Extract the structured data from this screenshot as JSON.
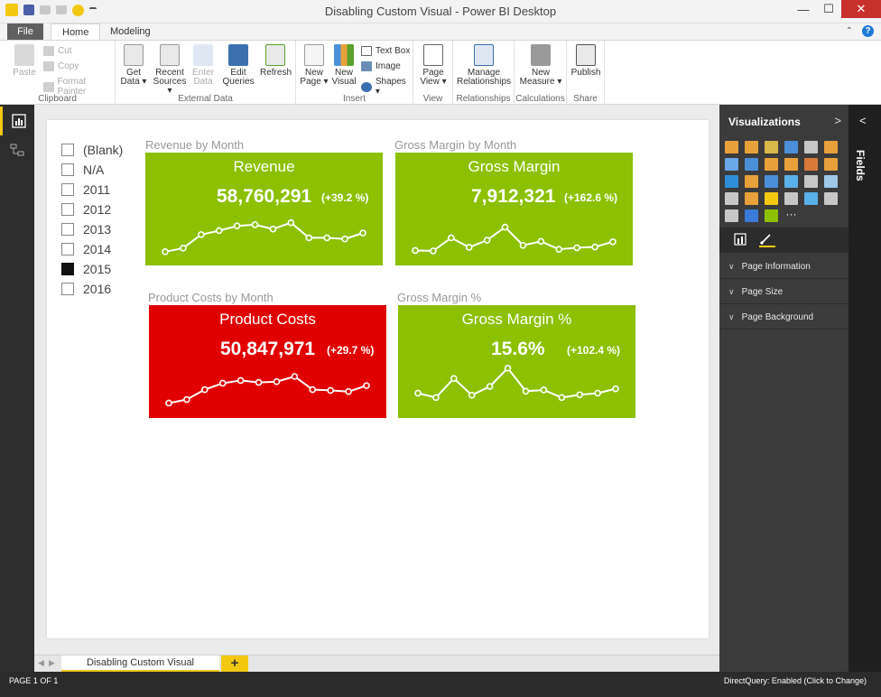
{
  "window": {
    "title": "Disabling Custom Visual - Power BI Desktop"
  },
  "window_controls": {
    "minimize": "—",
    "maximize": "☐",
    "close": "✕"
  },
  "tabs": {
    "file": "File",
    "home": "Home",
    "modeling": "Modeling"
  },
  "ribbon": {
    "clipboard": {
      "label": "Clipboard",
      "paste": "Paste",
      "cut": "Cut",
      "copy": "Copy",
      "format_painter": "Format Painter"
    },
    "external_data": {
      "label": "External Data",
      "get_data": "Get Data ▾",
      "recent_sources": "Recent Sources ▾",
      "enter_data": "Enter Data",
      "edit_queries": "Edit Queries",
      "refresh": "Refresh"
    },
    "insert": {
      "label": "Insert",
      "new_page": "New Page ▾",
      "new_visual": "New Visual",
      "text_box": "Text Box",
      "image": "Image",
      "shapes": "Shapes ▾"
    },
    "view": {
      "label": "View",
      "page_view": "Page View ▾"
    },
    "relationships": {
      "label": "Relationships",
      "manage": "Manage Relationships"
    },
    "calculations": {
      "label": "Calculations",
      "new_measure": "New Measure ▾"
    },
    "share": {
      "label": "Share",
      "publish": "Publish"
    }
  },
  "slicer": {
    "items": [
      {
        "label": "(Blank)",
        "checked": false
      },
      {
        "label": "N/A",
        "checked": false
      },
      {
        "label": "2011",
        "checked": false
      },
      {
        "label": "2012",
        "checked": false
      },
      {
        "label": "2013",
        "checked": false
      },
      {
        "label": "2014",
        "checked": false
      },
      {
        "label": "2015",
        "checked": true
      },
      {
        "label": "2016",
        "checked": false
      }
    ]
  },
  "cards": [
    {
      "visual_title": "Revenue by Month",
      "title": "Revenue",
      "value": "58,760,291",
      "change": "(+39.2 %)",
      "color": "#8cc000",
      "sparkline": [
        5,
        14,
        48,
        58,
        70,
        73,
        62,
        78,
        40,
        40,
        37,
        52
      ]
    },
    {
      "visual_title": "Gross Margin by Month",
      "title": "Gross Margin",
      "value": "7,912,321",
      "change": "(+162.6 %)",
      "color": "#8cc000",
      "sparkline": [
        8,
        7,
        40,
        16,
        34,
        67,
        21,
        31,
        11,
        15,
        17,
        30
      ]
    },
    {
      "visual_title": "Product Costs by Month",
      "title": "Product Costs",
      "value": "50,847,971",
      "change": "(+29.7 %)",
      "color": "#e00000",
      "sparkline": [
        8,
        17,
        42,
        58,
        65,
        60,
        62,
        75,
        42,
        40,
        37,
        52
      ]
    },
    {
      "visual_title": "Gross Margin %",
      "title": "Gross Margin %",
      "value": "15.6%",
      "change": "(+102.4 %)",
      "color": "#8cc000",
      "sparkline": [
        33,
        22,
        70,
        28,
        50,
        96,
        38,
        41,
        22,
        29,
        33,
        44
      ]
    }
  ],
  "viz_pane": {
    "title": "Visualizations",
    "more": "···",
    "sections": [
      "Page Information",
      "Page Size",
      "Page Background"
    ],
    "icon_colors": [
      "#e8a13a",
      "#e8a13a",
      "#d9b84a",
      "#4a8fd8",
      "#c7c7c7",
      "#e8a13a",
      "#6aa6e8",
      "#4a8fd8",
      "#e8a13a",
      "#e8a13a",
      "#d97a3a",
      "#e8a13a",
      "#2d8fd8",
      "#e8a13a",
      "#4a8fd8",
      "#5ab0e8",
      "#c7c7c7",
      "#9fc7e8",
      "#c7c7c7",
      "#e8a13a",
      "#f2c811",
      "#c7c7c7",
      "#5ab0e8",
      "#c7c7c7",
      "#c7c7c7",
      "#3a7ad8",
      "#8cc000"
    ]
  },
  "fields_pane": {
    "label": "Fields"
  },
  "page_tabs": {
    "active": "Disabling Custom Visual",
    "add": "+",
    "prev": "◀",
    "next": "▶"
  },
  "status": {
    "left": "PAGE 1 OF 1",
    "right": "DirectQuery: Enabled (Click to Change)"
  }
}
